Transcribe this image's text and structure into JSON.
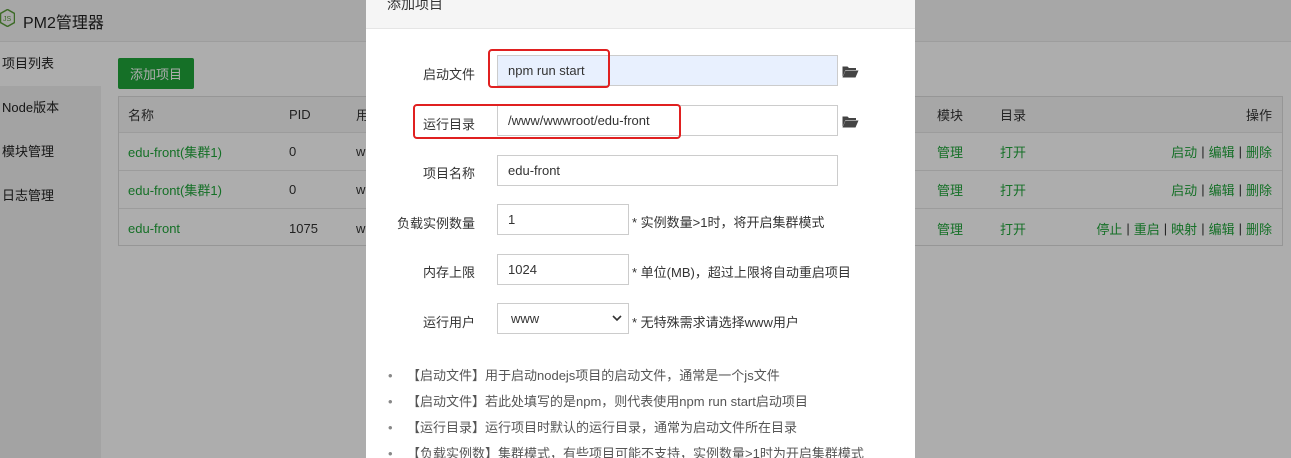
{
  "app": {
    "title": "PM2管理器"
  },
  "sidebar": {
    "items": [
      {
        "label": "项目列表"
      },
      {
        "label": "Node版本"
      },
      {
        "label": "模块管理"
      },
      {
        "label": "日志管理"
      }
    ]
  },
  "toolbar": {
    "add_label": "添加项目"
  },
  "table": {
    "columns": {
      "name": "名称",
      "pid": "PID",
      "user_partial": "用",
      "module": "模块",
      "dir": "目录",
      "ops": "操作"
    },
    "rows": [
      {
        "name": "edu-front(集群1)",
        "pid": "0",
        "user_partial": "w",
        "module": "管理",
        "dir": "打开",
        "ops": [
          "启动",
          "编辑",
          "删除"
        ]
      },
      {
        "name": "edu-front(集群1)",
        "pid": "0",
        "user_partial": "w",
        "module": "管理",
        "dir": "打开",
        "ops": [
          "启动",
          "编辑",
          "删除"
        ]
      },
      {
        "name": "edu-front",
        "pid": "1075",
        "user_partial": "w",
        "module": "管理",
        "dir": "打开",
        "ops": [
          "停止",
          "重启",
          "映射",
          "编辑",
          "删除"
        ]
      }
    ],
    "op_separator": "|"
  },
  "modal": {
    "title": "添加项目",
    "fields": {
      "start_file": {
        "label": "启动文件",
        "value": "npm run start"
      },
      "run_dir": {
        "label": "运行目录",
        "value": "/www/wwwroot/edu-front"
      },
      "project_name": {
        "label": "项目名称",
        "value": "edu-front"
      },
      "instances": {
        "label": "负载实例数量",
        "value": "1",
        "hint": "* 实例数量>1时，将开启集群模式"
      },
      "memory": {
        "label": "内存上限",
        "value": "1024",
        "hint": "* 单位(MB)，超过上限将自动重启项目"
      },
      "run_user": {
        "label": "运行用户",
        "value": "www",
        "hint": "* 无特殊需求请选择www用户"
      }
    },
    "notes": [
      "【启动文件】用于启动nodejs项目的启动文件，通常是一个js文件",
      "【启动文件】若此处填写的是npm，则代表使用npm run start启动项目",
      "【运行目录】运行项目时默认的运行目录，通常为启动文件所在目录",
      "【负载实例数】集群模式，有些项目可能不支持，实例数量>1时为开启集群模式"
    ]
  },
  "colors": {
    "accent": "#20a53a",
    "highlight": "#e02020",
    "autofill": "#e8f0fe"
  },
  "icons": {
    "folder": "folder-open-icon",
    "logo": "nodejs-icon",
    "select": "chevron-down-icon"
  }
}
